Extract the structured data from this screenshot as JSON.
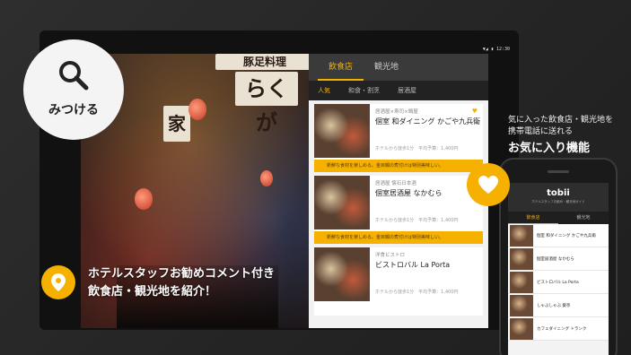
{
  "tablet": {
    "status": "▼◢ ▮ 12:30",
    "photo_signs": [
      "豚足料理",
      "らくが",
      "家"
    ],
    "app": {
      "tabs": [
        {
          "label": "飲食店",
          "active": true
        },
        {
          "label": "観光地",
          "active": false
        }
      ],
      "subtabs": [
        {
          "label": "人気",
          "active": true
        },
        {
          "label": "和食・割烹",
          "active": false
        },
        {
          "label": "居酒屋",
          "active": false
        }
      ],
      "cards": [
        {
          "category": "居酒屋×寿司×鍋屋",
          "name": "個室 和ダイニング かごや九兵衛",
          "meta": "ホテルから徒歩1分　平均予算：1,400円",
          "comment": "新鮮な食材を楽しめる。金目鯛の煮付けは特別美味しい。"
        },
        {
          "category": "居酒屋 懐石日本酒",
          "name": "個室居酒屋 なかむら",
          "meta": "ホテルから徒歩1分　平均予算：1,400円",
          "comment": "新鮮な食材を楽しめる。金目鯛の煮付けは特別美味しい。"
        },
        {
          "category": "洋食ビストロ",
          "name": "ビストロバル La Porta",
          "meta": "ホテルから徒歩1分　平均予算：1,400円",
          "comment": ""
        }
      ]
    }
  },
  "search_badge": {
    "label": "みつける"
  },
  "caption": {
    "line1": "ホテルスタッフお勧めコメント付き",
    "line2": "飲食店・観光地を紹介！"
  },
  "favorites": {
    "sub_line1": "気に入った飲食店・観光地を",
    "sub_line2": "携帯電話に送れる",
    "title": "お気に入り機能"
  },
  "phone": {
    "brand": "tobii",
    "tagline": "ホテルスタッフお勧め・観光地ガイド",
    "tabs": [
      {
        "label": "飲食店",
        "active": true
      },
      {
        "label": "観光地",
        "active": false
      }
    ],
    "items": [
      {
        "name": "個室 和ダイニング かごや九兵衛"
      },
      {
        "name": "個室居酒屋 なかむら"
      },
      {
        "name": "ビストロバル La Porta"
      },
      {
        "name": "しゃぶしゃぶ 葵亭"
      },
      {
        "name": "カフェダイニング トランク"
      }
    ]
  },
  "colors": {
    "accent": "#f5b000",
    "dark": "#2b2b2b"
  },
  "icons": [
    "search-icon",
    "map-pin-icon",
    "heart-icon",
    "thumbs-up-icon"
  ]
}
